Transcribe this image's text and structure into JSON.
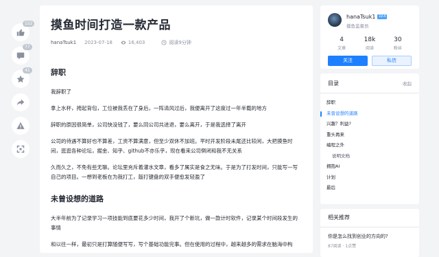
{
  "side_actions": {
    "like_count": "152",
    "comment_count": "77",
    "collect_count": "41"
  },
  "article": {
    "title": "摸鱼时间打造一款产品",
    "author": "hanaTsuk1",
    "date": "2023-07-18",
    "views": "16,403",
    "read_time": "阅读9分钟",
    "sections": [
      {
        "heading": "辞职",
        "paragraphs": [
          "我辞职了",
          "拿上水杯，挎起背包，工位被我丢在了身后，一阵清风过后，我便离开了这度过一年半载的地方",
          "辞职的原因很简单，公司快没钱了，要么同公司共进退，要么离开，于是我选择了离开",
          "公司的待遇不算好也不算差，工资不算满意，但至少双休不加班。平时开发阶段未尾还比较闲，大把摸鱼时间，逛逛各种论坛，掘金、知乎、github不亦乐乎，现在看来公司倒闭和我不无关系",
          "久而久之，不免有些无聊。论坛里充斥着灌水文章，看多了属实是食之无味。于是为了打发时间，只能写一写自己的项目。一想到老板在为我打工，敲打键盘的双手便愈发轻盈了"
        ]
      },
      {
        "heading": "未曾设想的道路",
        "paragraphs": [
          "大半年前为了记录学习一项技能到底要花多少时间，我开了个新坑，做一款计时软件，记录某个时间段发生的事情",
          "和以往一样，最初只是打算随便写写，写个基础功能完事。但在使用的过程中，越来越多的需求在脑海中构"
        ]
      }
    ]
  },
  "author_card": {
    "name": "hanaTsuk1",
    "level": "LV.4",
    "slogan": "摸鱼监督员",
    "stats": [
      {
        "num": "4",
        "label": "文章"
      },
      {
        "num": "18k",
        "label": "阅读"
      },
      {
        "num": "30",
        "label": "粉丝"
      }
    ],
    "follow_label": "关注",
    "message_label": "私信"
  },
  "toc": {
    "title": "目录",
    "fold_label": "收起",
    "items": [
      {
        "label": "辞职",
        "level": 1,
        "active": false
      },
      {
        "label": "未曾设想的道路",
        "level": 1,
        "active": true
      },
      {
        "label": "兴趣？利益?",
        "level": 1,
        "active": false
      },
      {
        "label": "重头再来",
        "level": 1,
        "active": false
      },
      {
        "label": "编程之外",
        "level": 1,
        "active": false
      },
      {
        "label": "说明文档",
        "level": 2,
        "active": false
      },
      {
        "label": "拥抱AI",
        "level": 1,
        "active": false
      },
      {
        "label": "计划",
        "level": 1,
        "active": false
      },
      {
        "label": "最后",
        "level": 1,
        "active": false
      }
    ]
  },
  "related": {
    "title": "相关推荐",
    "item_title": "你是怎么找到创业的方向的?",
    "item_meta": "87阅读 · 1点赞"
  }
}
